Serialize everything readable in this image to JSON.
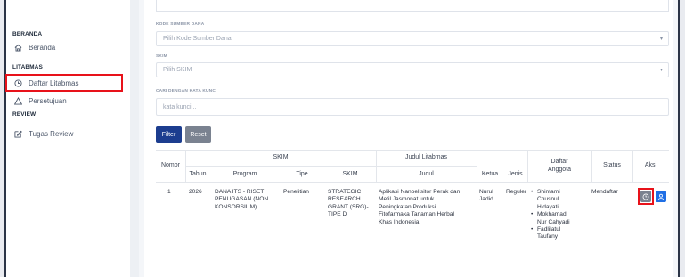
{
  "sidebar": {
    "sections": [
      {
        "title": "BERANDA",
        "items": [
          {
            "label": "Beranda",
            "icon": "home-icon"
          }
        ]
      },
      {
        "title": "LITABMAS",
        "items": [
          {
            "label": "Daftar Litabmas",
            "icon": "clock-icon",
            "highlighted": true
          },
          {
            "label": "Persetujuan",
            "icon": "warning-icon"
          }
        ]
      },
      {
        "title": "REVIEW",
        "items": [
          {
            "label": "Tugas Review",
            "icon": "edit-icon"
          }
        ]
      }
    ]
  },
  "filters": {
    "kode_sumber_dana": {
      "label": "KODE SUMBER DANA",
      "placeholder": "Pilih Kode Sumber Dana"
    },
    "skim": {
      "label": "SKIM",
      "placeholder": "Pilih SKIM"
    },
    "keyword": {
      "label": "CARI DENGAN KATA KUNCI",
      "placeholder": "kata kunci..."
    },
    "filter_label": "Filter",
    "reset_label": "Reset"
  },
  "table": {
    "headers": {
      "nomor": "Nomor",
      "skim_group": "SKIM",
      "tahun": "Tahun",
      "program": "Program",
      "tipe": "Tipe",
      "skim": "SKIM",
      "judul_group": "Judul Litabmas",
      "judul": "Judul",
      "ketua": "Ketua",
      "jenis": "Jenis",
      "daftar_anggota_1": "Daftar",
      "daftar_anggota_2": "Anggota",
      "status": "Status",
      "aksi": "Aksi"
    },
    "rows": [
      {
        "nomor": "1",
        "tahun": "2026",
        "program": [
          "DANA ITS - RISET",
          "PENUGASAN (NON",
          "KONSORSIUM)"
        ],
        "tipe": "Penelitian",
        "skim": [
          "STRATEGIC",
          "RESEARCH",
          "GRANT (SRG)-",
          "TIPE D"
        ],
        "judul": [
          "Aplikasi Nanoelisitor Perak dan",
          "Metil Jasmonat untuk",
          "Peningkatan Produksi",
          "Fitofarmaka Tanaman Herbal",
          "Khas Indonesia"
        ],
        "ketua": [
          "Nurul",
          "Jadid"
        ],
        "jenis": "Reguler",
        "anggota": [
          [
            "Shintami",
            "Chusnul",
            "Hidayati"
          ],
          [
            "Mokhamad",
            "Nur Cahyadi"
          ],
          [
            "Fadlilatul",
            "Taufany"
          ]
        ],
        "status": "Mendaftar"
      }
    ]
  },
  "colors": {
    "accent": "#1c3d8f",
    "reset": "#7a8290",
    "highlight": "#e8121a",
    "action_blue": "#1f6fe5"
  }
}
